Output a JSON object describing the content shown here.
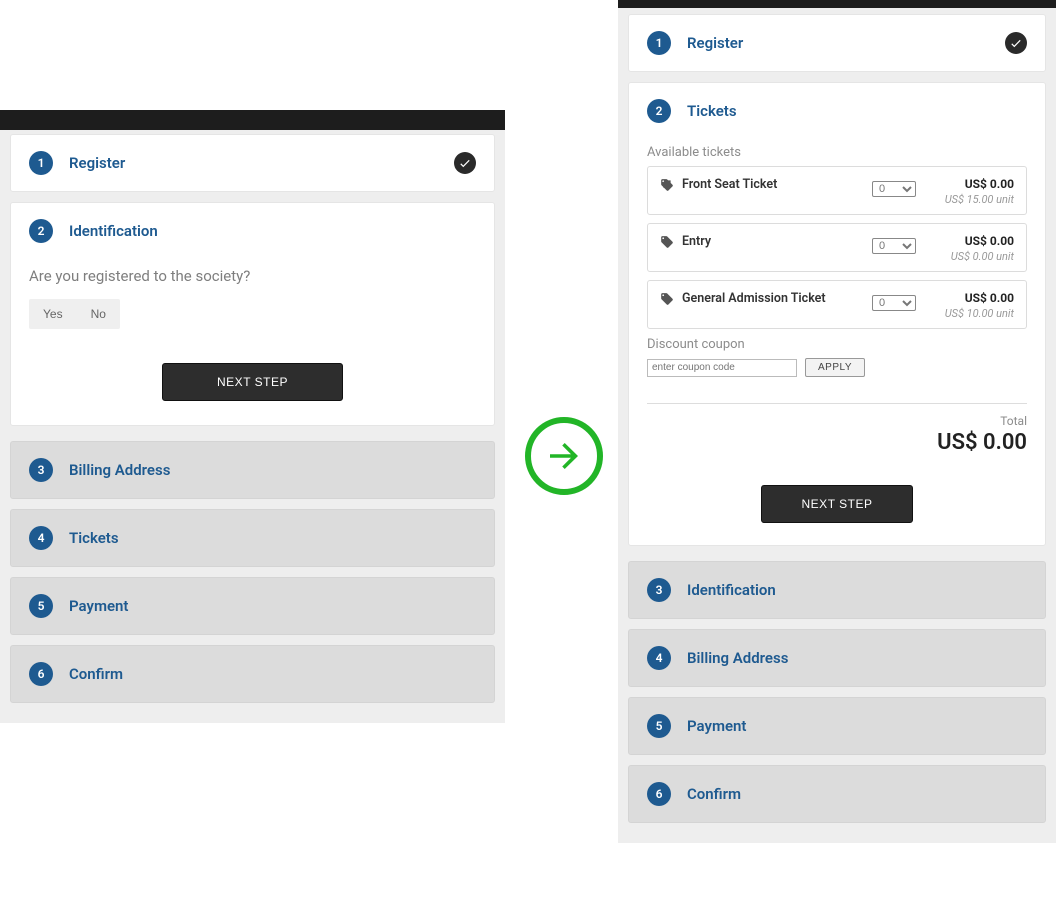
{
  "left": {
    "steps": {
      "register": {
        "num": "1",
        "title": "Register",
        "completed": true
      },
      "identification": {
        "num": "2",
        "title": "Identification",
        "question": "Are you registered to the society?",
        "yes": "Yes",
        "no": "No",
        "next": "NEXT STEP"
      },
      "billing": {
        "num": "3",
        "title": "Billing Address"
      },
      "tickets": {
        "num": "4",
        "title": "Tickets"
      },
      "payment": {
        "num": "5",
        "title": "Payment"
      },
      "confirm": {
        "num": "6",
        "title": "Confirm"
      }
    }
  },
  "right": {
    "steps": {
      "register": {
        "num": "1",
        "title": "Register",
        "completed": true
      },
      "tickets": {
        "num": "2",
        "title": "Tickets",
        "available_label": "Available tickets",
        "items": [
          {
            "name": "Front Seat Ticket",
            "qty": "0",
            "price": "US$ 0.00",
            "unit": "US$ 15.00 unit"
          },
          {
            "name": "Entry",
            "qty": "0",
            "price": "US$ 0.00",
            "unit": "US$ 0.00 unit"
          },
          {
            "name": "General Admission Ticket",
            "qty": "0",
            "price": "US$ 0.00",
            "unit": "US$ 10.00 unit"
          }
        ],
        "coupon_label": "Discount coupon",
        "coupon_placeholder": "enter coupon code",
        "apply": "APPLY",
        "total_label": "Total",
        "total_amount": "US$ 0.00",
        "next": "NEXT STEP"
      },
      "identification": {
        "num": "3",
        "title": "Identification"
      },
      "billing": {
        "num": "4",
        "title": "Billing Address"
      },
      "payment": {
        "num": "5",
        "title": "Payment"
      },
      "confirm": {
        "num": "6",
        "title": "Confirm"
      }
    }
  }
}
